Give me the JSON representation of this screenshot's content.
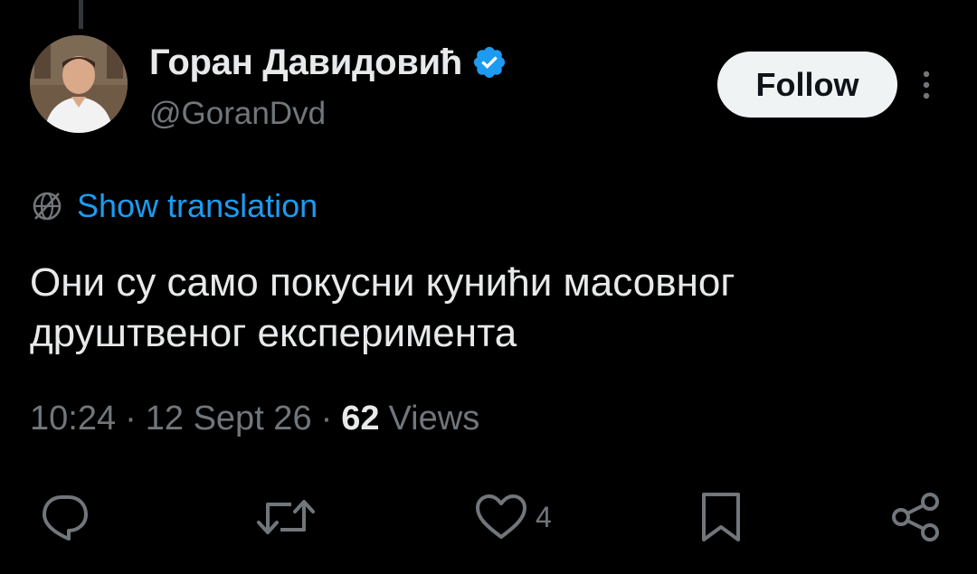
{
  "author": {
    "display_name": "Горан Давидовић",
    "handle": "@GoranDvd",
    "verified": true
  },
  "follow_button": {
    "label": "Follow"
  },
  "translation": {
    "label": "Show translation"
  },
  "tweet": {
    "text": "Они су само покусни кунићи масовног друштвеног експеримента"
  },
  "meta": {
    "time": "10:24",
    "date": "12 Sept 26",
    "separator": "·",
    "views_count": "62",
    "views_label": "Views"
  },
  "actions": {
    "like_count": "4"
  },
  "icons": {
    "verified": "verified-badge-icon",
    "more": "more-vertical-icon",
    "translate": "globe-translate-icon",
    "reply": "reply-icon",
    "retweet": "retweet-icon",
    "like": "heart-icon",
    "bookmark": "bookmark-icon",
    "share": "share-icon"
  },
  "colors": {
    "background": "#000000",
    "text_primary": "#e7e9ea",
    "text_secondary": "#71767b",
    "accent_blue": "#1d9bf0",
    "follow_bg": "#eff3f4"
  }
}
